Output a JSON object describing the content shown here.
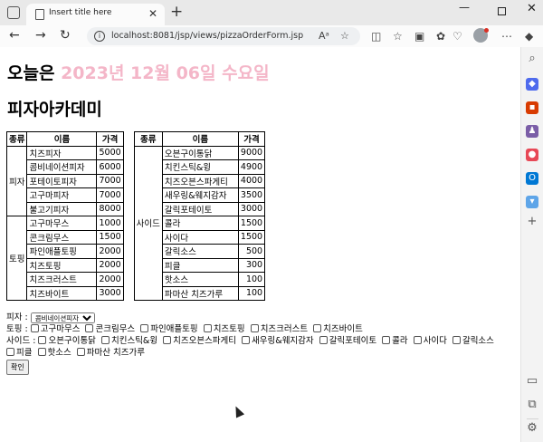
{
  "browser": {
    "tab_title": "Insert title here",
    "url": "localhost:8081/jsp/views/pizzaOrderForm.jsp"
  },
  "page": {
    "date_label": "오늘은 ",
    "date_value": "2023년 12월 06일 수요일",
    "title": "피자아카데미"
  },
  "table": {
    "headers": [
      "종류",
      "이름",
      "가격",
      "종류",
      "이름",
      "가격"
    ],
    "pizza_category": "피자",
    "topping_category": "토핑",
    "side_category": "사이드",
    "left_rows": [
      {
        "name": "치즈피자",
        "price": "5000"
      },
      {
        "name": "콤비네이션피자",
        "price": "6000"
      },
      {
        "name": "포테이토피자",
        "price": "7000"
      },
      {
        "name": "고구마피자",
        "price": "7000"
      },
      {
        "name": "불고기피자",
        "price": "8000"
      },
      {
        "name": "고구마무스",
        "price": "1000"
      },
      {
        "name": "콘크림무스",
        "price": "1500"
      },
      {
        "name": "파인애플토핑",
        "price": "2000"
      },
      {
        "name": "치즈토핑",
        "price": "2000"
      },
      {
        "name": "치즈크러스트",
        "price": "2000"
      },
      {
        "name": "치즈바이트",
        "price": "3000"
      }
    ],
    "right_rows": [
      {
        "name": "오븐구이통닭",
        "price": "9000"
      },
      {
        "name": "치킨스틱&윙",
        "price": "4900"
      },
      {
        "name": "치즈오븐스파게티",
        "price": "4000"
      },
      {
        "name": "새우링&웨지감자",
        "price": "3500"
      },
      {
        "name": "갈릭포테이토",
        "price": "3000"
      },
      {
        "name": "콜라",
        "price": "1500"
      },
      {
        "name": "사이다",
        "price": "1500"
      },
      {
        "name": "갈릭소스",
        "price": "500"
      },
      {
        "name": "피클",
        "price": "300"
      },
      {
        "name": "핫소스",
        "price": "100"
      },
      {
        "name": "파마산 치즈가루",
        "price": "100"
      }
    ]
  },
  "form": {
    "pizza_label": "피자 :",
    "pizza_selected": "콤비네이션피자",
    "topping_label": "토핑 :",
    "toppings": [
      "고구마무스",
      "콘크림무스",
      "파인애플토핑",
      "치즈토핑",
      "치즈크러스트",
      "치즈바이트"
    ],
    "side_label": "사이드 :",
    "sides": [
      "오븐구이통닭",
      "치킨스틱&윙",
      "치즈오븐스파게티",
      "새우링&웨지감자",
      "갈릭포테이토",
      "콜라",
      "사이다",
      "갈릭소스",
      "피클",
      "핫소스",
      "파마산 치즈가루"
    ],
    "submit_label": "확인"
  }
}
